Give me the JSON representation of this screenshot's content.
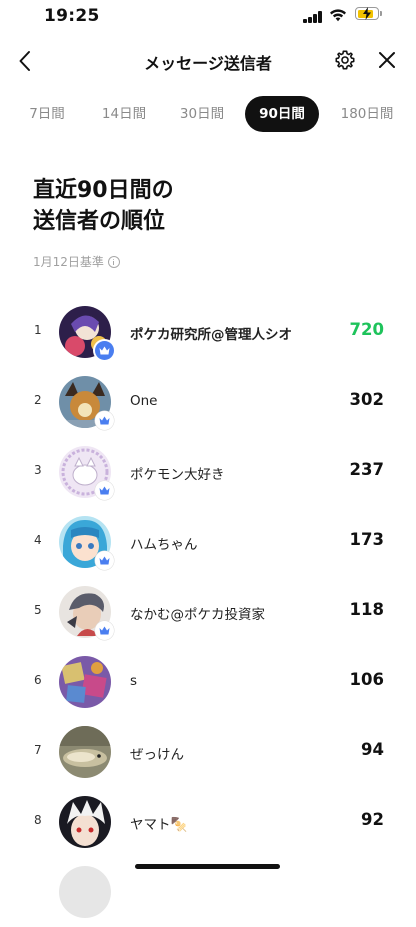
{
  "status": {
    "time": "19:25"
  },
  "nav": {
    "title": "メッセージ送信者"
  },
  "tabs": [
    {
      "label": "7日間"
    },
    {
      "label": "14日間"
    },
    {
      "label": "30日間"
    },
    {
      "label": "90日間",
      "active": true
    },
    {
      "label": "180日間"
    }
  ],
  "heading": {
    "line1": "直近90日間の",
    "line2": "送信者の順位"
  },
  "basis": {
    "label": "1月12日基準"
  },
  "colors": {
    "accent_green": "#1ec35b",
    "crown_blue": "#4a7ef0",
    "active_tab_bg": "#111111"
  },
  "ranking": [
    {
      "rank": "1",
      "name": "ポケカ研究所@管理人シオ",
      "count": "720"
    },
    {
      "rank": "2",
      "name": "One",
      "count": "302"
    },
    {
      "rank": "3",
      "name": "ポケモン大好き",
      "count": "237"
    },
    {
      "rank": "4",
      "name": "ハムちゃん",
      "count": "173"
    },
    {
      "rank": "5",
      "name": "なかむ@ポケカ投資家",
      "count": "118"
    },
    {
      "rank": "6",
      "name": "s",
      "count": "106"
    },
    {
      "rank": "7",
      "name": "ぜっけん",
      "count": "94"
    },
    {
      "rank": "8",
      "name": "ヤマト🍢",
      "count": "92"
    }
  ]
}
